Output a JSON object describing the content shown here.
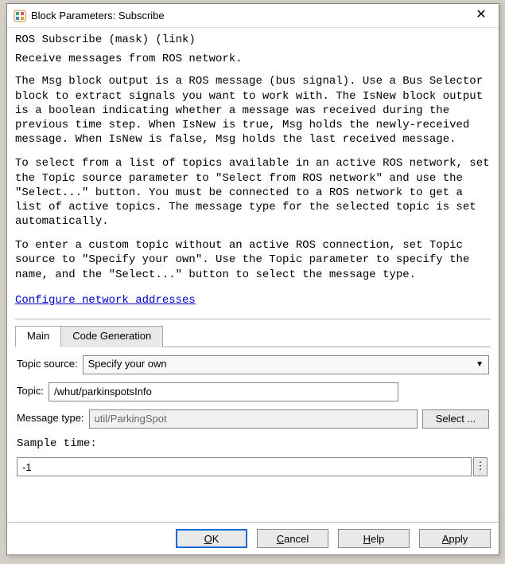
{
  "titlebar": {
    "title": "Block Parameters: Subscribe"
  },
  "mask_line": "ROS Subscribe (mask) (link)",
  "desc_short": "Receive messages from ROS network.",
  "desc_p1": "The Msg block output is a ROS message (bus signal). Use a Bus Selector block to extract signals you want to work with. The IsNew block output is a boolean indicating whether a message was received during the previous time step. When IsNew is true, Msg holds the newly-received message. When IsNew is false, Msg holds the last received message.",
  "desc_p2": "To select from a list of topics available in an active ROS network, set the Topic source parameter to \"Select from ROS network\" and use the \"Select...\" button. You must be connected to a ROS network to get a list of active topics. The message type for the selected topic is set automatically.",
  "desc_p3": "To enter a custom topic without an active ROS connection, set Topic source to \"Specify your own\". Use the Topic parameter to specify the name, and the \"Select...\" button to select the message type.",
  "link_label": "Configure network addresses",
  "tabs": {
    "main": "Main",
    "codegen": "Code Generation"
  },
  "form": {
    "topic_source_label": "Topic source:",
    "topic_source_value": "Specify your own",
    "topic_label": "Topic:",
    "topic_value": "/whut/parkinspotsInfo",
    "message_type_label": "Message type:",
    "message_type_value": "util/ParkingSpot",
    "select_button": "Select ...",
    "sample_time_label": "Sample time:",
    "sample_time_value": "-1",
    "more_button": "⋮"
  },
  "buttons": {
    "ok_prefix": "",
    "ok_accel": "O",
    "ok_suffix": "K",
    "cancel_prefix": "",
    "cancel_accel": "C",
    "cancel_suffix": "ancel",
    "help_prefix": "",
    "help_accel": "H",
    "help_suffix": "elp",
    "apply_prefix": "",
    "apply_accel": "A",
    "apply_suffix": "pply"
  }
}
